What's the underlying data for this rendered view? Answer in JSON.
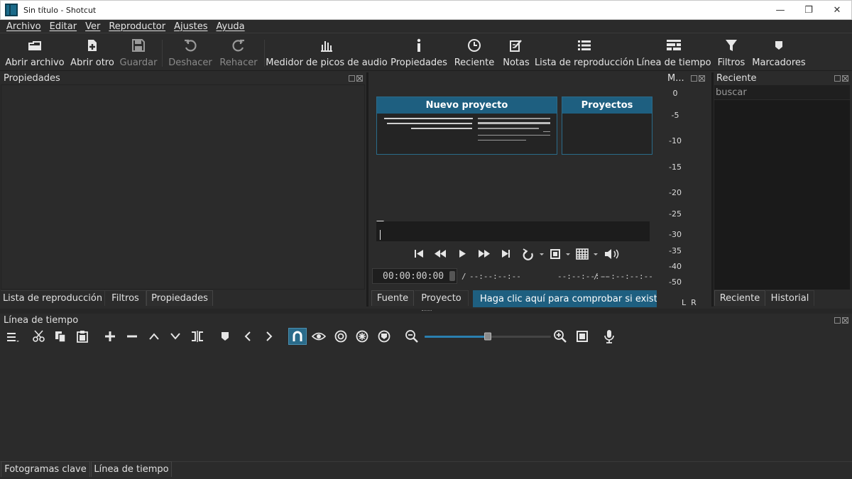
{
  "window": {
    "title": "Sin título - Shotcut",
    "minimize": "—",
    "maximize": "❐",
    "close": "✕"
  },
  "menu": [
    "Archivo",
    "Editar",
    "Ver",
    "Reproductor",
    "Ajustes",
    "Ayuda"
  ],
  "toolbar": {
    "open_file": "Abrir archivo",
    "open_other": "Abrir otro",
    "save": "Guardar",
    "undo": "Deshacer",
    "redo": "Rehacer",
    "audio_meter": "Medidor de picos de audio",
    "properties": "Propiedades",
    "recent": "Reciente",
    "notes": "Notas",
    "playlist": "Lista de reproducción",
    "timeline": "Línea de tiempo",
    "filters": "Filtros",
    "markers": "Marcadores"
  },
  "properties_panel": {
    "title": "Propiedades",
    "tabs": [
      "Lista de reproducción",
      "Filtros",
      "Propiedades"
    ]
  },
  "player": {
    "new_project": "Nuevo proyecto",
    "projects": "Proyectos",
    "timecode": "00:00:00:00",
    "duration": "--:--:--:--",
    "in_point": "--:--:--:--",
    "out_point": "--:--:--:--",
    "slash": "/",
    "tabs": [
      "Fuente",
      "Proyecto"
    ],
    "update_banner": "Haga clic aquí para comprobar si exist…"
  },
  "meter": {
    "title": "M...",
    "scale": [
      "0",
      "-5",
      "-10",
      "-15",
      "-20",
      "-25",
      "-30",
      "-35",
      "-40",
      "-50"
    ],
    "channels": "L  R"
  },
  "recent_panel": {
    "title": "Reciente",
    "search_placeholder": "buscar",
    "tabs": [
      "Reciente",
      "Historial"
    ]
  },
  "timeline_panel": {
    "title": "Línea de tiempo",
    "tabs": [
      "Fotogramas clave",
      "Línea de tiempo"
    ],
    "zoom_level": 0.5
  },
  "colors": {
    "accent": "#1e5f80",
    "background": "#2b2b2b",
    "snap_active": "#2a6b8a"
  }
}
